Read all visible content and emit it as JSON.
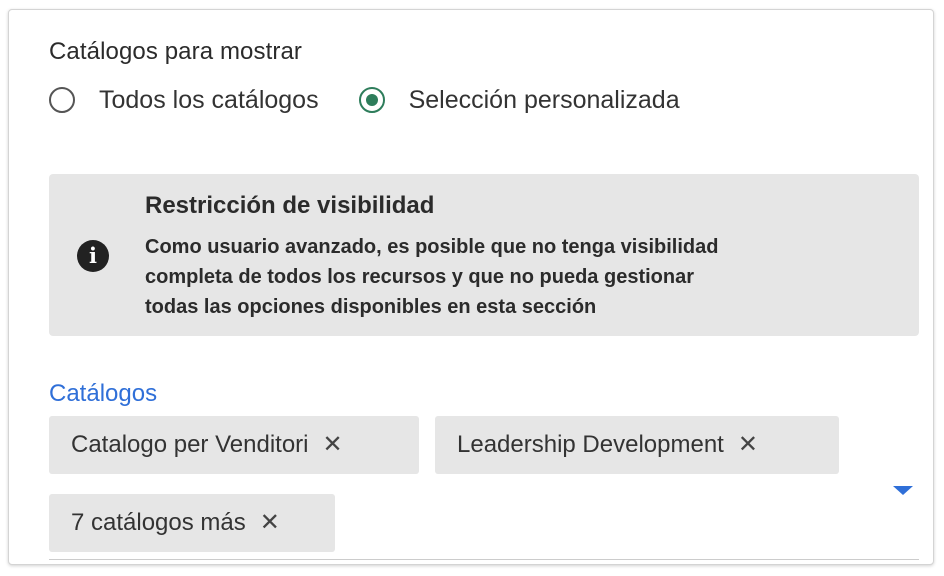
{
  "section": {
    "title": "Catálogos para mostrar"
  },
  "radios": [
    {
      "label": "Todos los catálogos",
      "checked": false
    },
    {
      "label": "Selección personalizada",
      "checked": true
    }
  ],
  "notice": {
    "icon": "info-icon",
    "icon_glyph": "i",
    "title": "Restricción de visibilidad",
    "lines": [
      "Como usuario avanzado, es posible que no tenga visibilidad",
      "completa de todos los recursos y que no pueda gestionar",
      "todas las opciones disponibles en esta sección"
    ]
  },
  "catalogs": {
    "label": "Catálogos",
    "chips": [
      "Catalogo per Venditori",
      "Leadership Development",
      "7 catálogos más"
    ],
    "remove_glyph": "✕",
    "dropdown_icon": "caret-down-icon"
  },
  "colors": {
    "accent_blue": "#2f6fd8",
    "radio_green": "#2e7d5b",
    "notice_bg": "#e6e6e6",
    "chip_bg": "#e6e6e6"
  }
}
